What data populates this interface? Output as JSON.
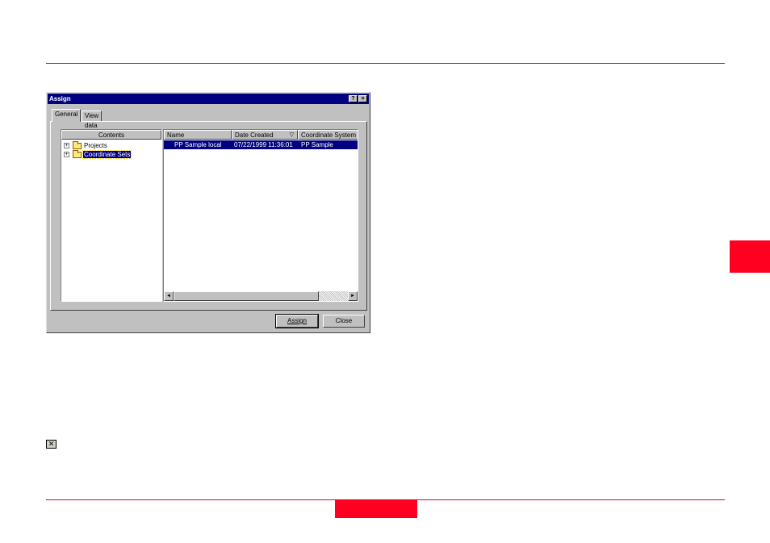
{
  "dialog": {
    "title": "Assign",
    "help_label": "?",
    "close_label": "×",
    "tabs": [
      {
        "label": "General",
        "active": true
      },
      {
        "label": "View data",
        "active": false
      }
    ]
  },
  "tree": {
    "header": "Contents",
    "items": [
      {
        "label": "Projects",
        "expander": "+",
        "icon": "folder-icon",
        "selected": false
      },
      {
        "label": "Coordinate Sets",
        "expander": "+",
        "icon": "folder-icon",
        "selected": true
      }
    ]
  },
  "list": {
    "columns": [
      "Name",
      "Date Created",
      "Coordinate System"
    ],
    "sort_indicator": "▽",
    "rows": [
      {
        "name": "PP Sample local",
        "date_created": "07/22/1999 11:36:01",
        "coordinate_system": "PP Sample",
        "selected": true
      }
    ],
    "scroll_left": "◄",
    "scroll_right": "►"
  },
  "buttons": {
    "assign": "Assign",
    "close": "Close"
  },
  "footer": {
    "close_icon_glyph": "✕"
  },
  "colors": {
    "accent_red": "#e0001a",
    "selection": "#000080"
  }
}
